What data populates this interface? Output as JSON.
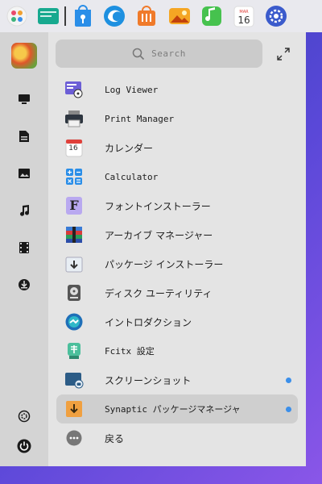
{
  "dock": {
    "items": [
      {
        "name": "launcher-app-icon"
      },
      {
        "name": "file-manager-icon"
      },
      {
        "name": "app-store-icon"
      },
      {
        "name": "browser-icon"
      },
      {
        "name": "shopping-bag-icon"
      },
      {
        "name": "image-viewer-icon"
      },
      {
        "name": "music-player-icon"
      },
      {
        "name": "calendar-icon",
        "month": "MAR",
        "day": "16"
      },
      {
        "name": "settings-icon"
      }
    ]
  },
  "rail": {
    "items": [
      {
        "name": "desktop-icon"
      },
      {
        "name": "document-icon"
      },
      {
        "name": "picture-icon"
      },
      {
        "name": "music-note-icon"
      },
      {
        "name": "video-icon"
      },
      {
        "name": "download-icon"
      }
    ],
    "bottom": [
      {
        "name": "control-center-icon"
      },
      {
        "name": "power-icon"
      }
    ]
  },
  "search": {
    "placeholder": "Search"
  },
  "apps": [
    {
      "label": "Log Viewer",
      "mono": true,
      "icon": "log-viewer-icon",
      "dot": false,
      "selected": false
    },
    {
      "label": "Print Manager",
      "mono": true,
      "icon": "printer-icon",
      "dot": false,
      "selected": false
    },
    {
      "label": "カレンダー",
      "mono": false,
      "icon": "calendar-app-icon",
      "dot": false,
      "selected": false,
      "day": "16"
    },
    {
      "label": "Calculator",
      "mono": true,
      "icon": "calculator-icon",
      "dot": false,
      "selected": false
    },
    {
      "label": "フォントインストーラー",
      "mono": false,
      "icon": "font-installer-icon",
      "dot": false,
      "selected": false,
      "glyph": "F"
    },
    {
      "label": "アーカイブ マネージャー",
      "mono": false,
      "icon": "archive-manager-icon",
      "dot": false,
      "selected": false
    },
    {
      "label": "パッケージ インストーラー",
      "mono": false,
      "icon": "package-installer-icon",
      "dot": false,
      "selected": false
    },
    {
      "label": "ディスク ユーティリティ",
      "mono": false,
      "icon": "disk-utility-icon",
      "dot": false,
      "selected": false
    },
    {
      "label": "イントロダクション",
      "mono": false,
      "icon": "introduction-icon",
      "dot": false,
      "selected": false
    },
    {
      "label": "Fcitx 設定",
      "mono": true,
      "icon": "fcitx-settings-icon",
      "dot": false,
      "selected": false
    },
    {
      "label": "スクリーンショット",
      "mono": false,
      "icon": "screenshot-icon",
      "dot": true,
      "selected": false
    },
    {
      "label": "Synaptic パッケージマネージャ",
      "mono": true,
      "icon": "synaptic-icon",
      "dot": true,
      "selected": true
    },
    {
      "label": "戻る",
      "mono": false,
      "icon": "more-icon",
      "dot": false,
      "selected": false
    }
  ],
  "colors": {
    "accent": "#3b8fea",
    "panel": "#e4e4e4",
    "rail": "#d4d4d4"
  }
}
